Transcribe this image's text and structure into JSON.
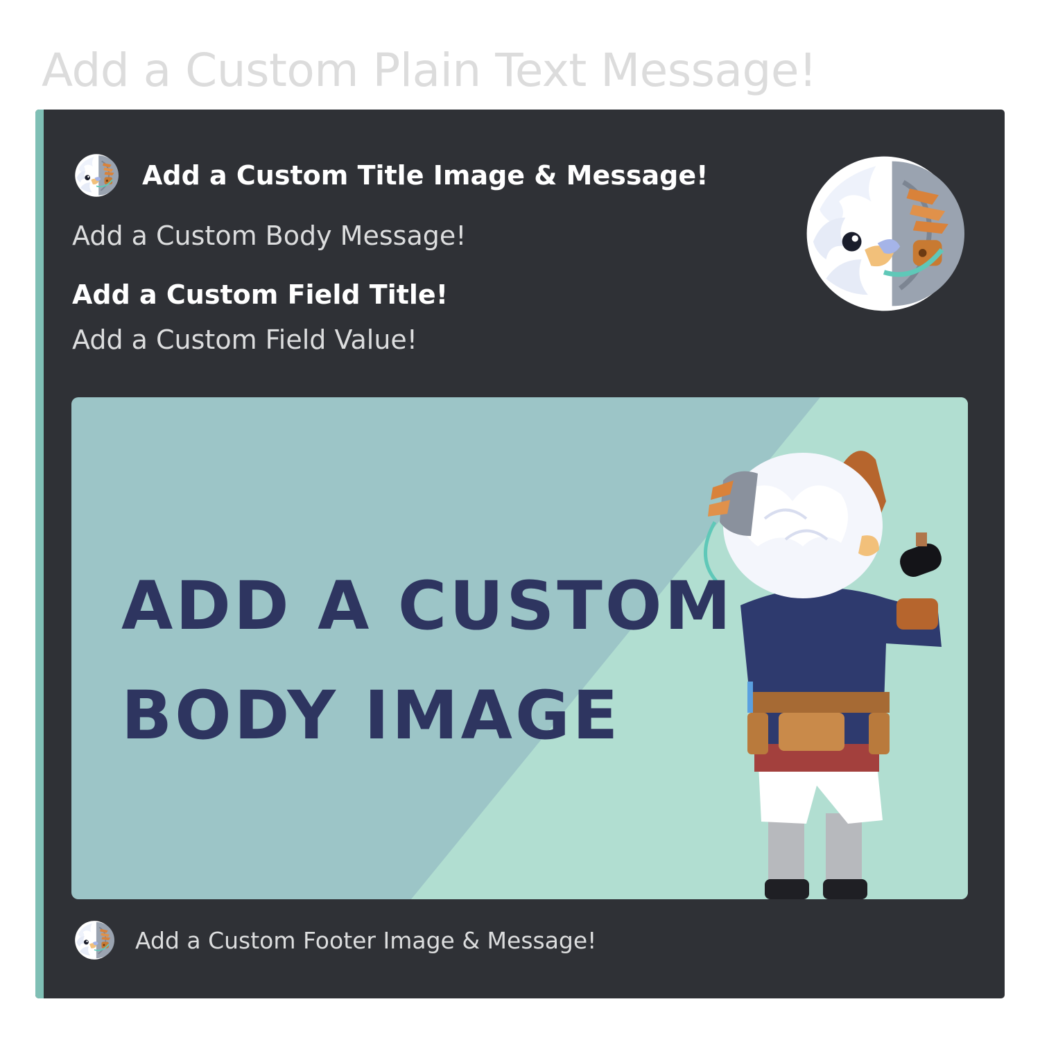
{
  "plain_message": "Add a Custom Plain Text Message!",
  "embed": {
    "accent_color": "#7fbfb5",
    "background_color": "#2f3136",
    "author": {
      "icon": "eagle-avatar-icon",
      "title": "Add a Custom Title Image & Message!"
    },
    "thumbnail": {
      "icon": "eagle-avatar-icon"
    },
    "body": "Add a Custom Body Message!",
    "field": {
      "title": "Add a Custom Field Title!",
      "value": "Add a Custom Field Value!"
    },
    "image": {
      "line1": "ADD A CUSTOM",
      "line2": "BODY IMAGE",
      "colors": {
        "background_left": "#9cc5c7",
        "background_right": "#b1ded1",
        "text": "#2e3560"
      }
    },
    "footer": {
      "icon": "eagle-avatar-icon",
      "text": "Add a Custom Footer Image & Message!"
    }
  }
}
